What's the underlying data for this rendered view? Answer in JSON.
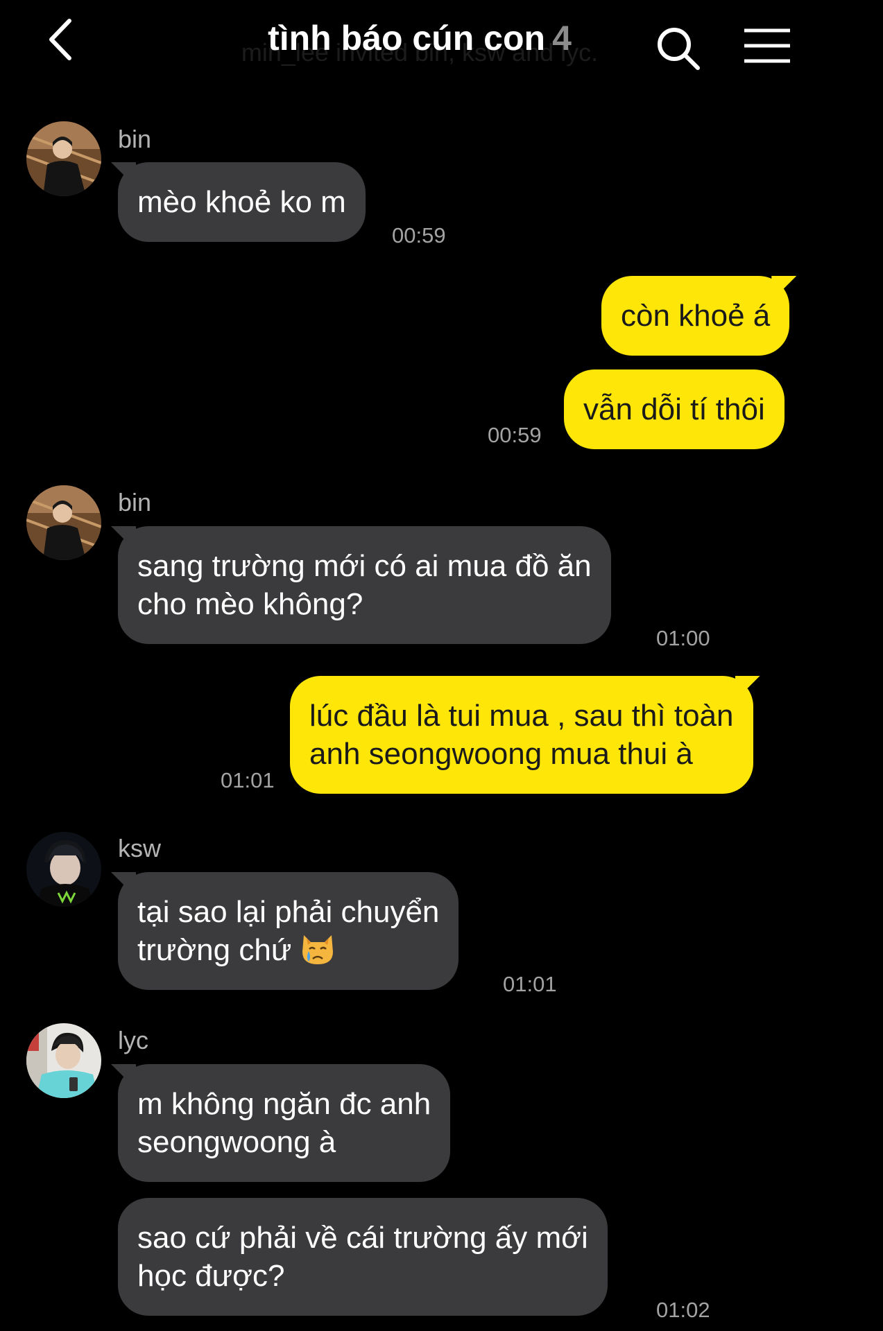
{
  "header": {
    "back_icon": "chevron-left-icon",
    "title": "tình báo cún con",
    "member_count": "4",
    "system_note": "min_lee invited bin, ksw and lyc.",
    "search_icon": "search-icon",
    "menu_icon": "hamburger-menu-icon"
  },
  "colors": {
    "background": "#000000",
    "incoming_bubble": "#3b3b3d",
    "outgoing_bubble": "#fde608",
    "timestamp": "#a3a3a3",
    "sender_name": "#b4b4b4",
    "member_count": "#8c8c8c"
  },
  "messages": [
    {
      "sender": "bin",
      "direction": "incoming",
      "lines": [
        "mèo khoẻ ko m"
      ],
      "time": "00:59"
    },
    {
      "direction": "outgoing",
      "lines": [
        "còn khoẻ á"
      ]
    },
    {
      "direction": "outgoing",
      "lines": [
        "vẫn dỗi tí thôi"
      ],
      "time": "00:59"
    },
    {
      "sender": "bin",
      "direction": "incoming",
      "lines": [
        "sang trường mới có ai mua đồ ăn",
        "cho mèo không?"
      ],
      "time": "01:00"
    },
    {
      "direction": "outgoing",
      "lines": [
        "lúc đầu là tui mua , sau thì toàn",
        "anh seongwoong mua thui à"
      ],
      "time": "01:01"
    },
    {
      "sender": "ksw",
      "direction": "incoming",
      "lines": [
        "tại sao lại phải chuyển",
        "trường chứ"
      ],
      "emoji": "crying-cat-face-icon",
      "time": "01:01"
    },
    {
      "sender": "lyc",
      "direction": "incoming",
      "lines": [
        "m không ngăn đc anh",
        "seongwoong à"
      ]
    },
    {
      "direction": "incoming",
      "lines": [
        "sao cứ phải về cái trường ấy mới",
        "học được?"
      ],
      "time": "01:02"
    }
  ]
}
